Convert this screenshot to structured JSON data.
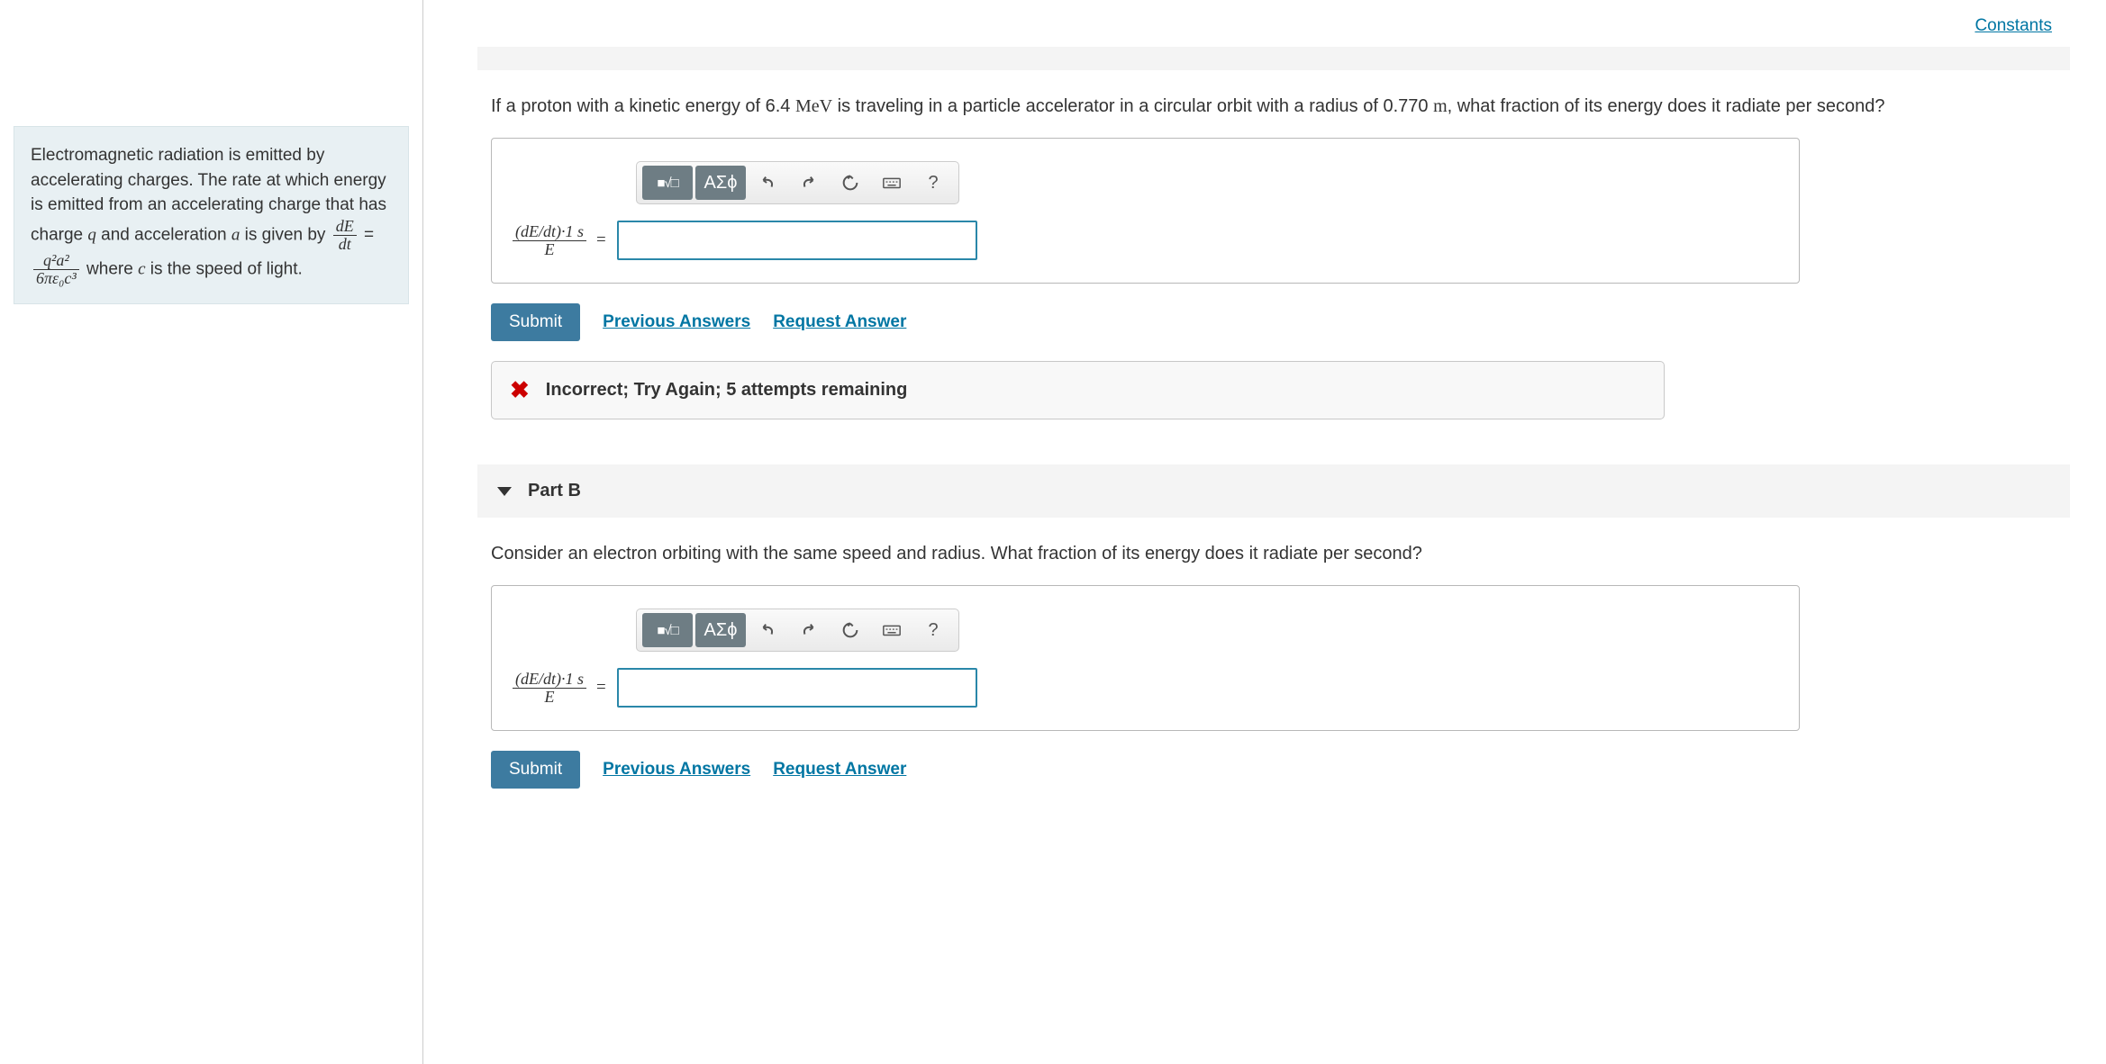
{
  "links": {
    "constants": "Constants"
  },
  "info": {
    "text1": "Electromagnetic radiation is emitted by accelerating charges. The rate at which energy is emitted from an accelerating charge that has charge ",
    "var_q": "q",
    "text2": " and acceleration ",
    "var_a": "a",
    "text3": " is given by ",
    "dE": "dE",
    "dt": "dt",
    "eq": " = ",
    "num": "q²a²",
    "den": "6πε₀c³",
    "text4": " where ",
    "var_c": "c",
    "text5": " is the speed of light."
  },
  "partA": {
    "question_pre": "If a proton with a kinetic energy of 6.4 ",
    "unit_energy": "MeV",
    "question_mid": " is traveling in a particle accelerator in a circular orbit with a radius of 0.770 ",
    "unit_length": "m",
    "question_post": ", what fraction of its energy does it radiate per second?",
    "lhs_num": "(dE/dt)·1 s",
    "lhs_den": "E",
    "equals": "=",
    "submit": "Submit",
    "prev": "Previous Answers",
    "request": "Request Answer",
    "feedback": "Incorrect; Try Again; 5 attempts remaining"
  },
  "partB": {
    "header": "Part B",
    "question": "Consider an electron orbiting with the same speed and radius. What fraction of its energy does it radiate per second?",
    "lhs_num": "(dE/dt)·1 s",
    "lhs_den": "E",
    "equals": "=",
    "submit": "Submit",
    "prev": "Previous Answers",
    "request": "Request Answer"
  },
  "toolbar": {
    "templates": "■√□",
    "greek": "ΑΣϕ",
    "help": "?"
  }
}
